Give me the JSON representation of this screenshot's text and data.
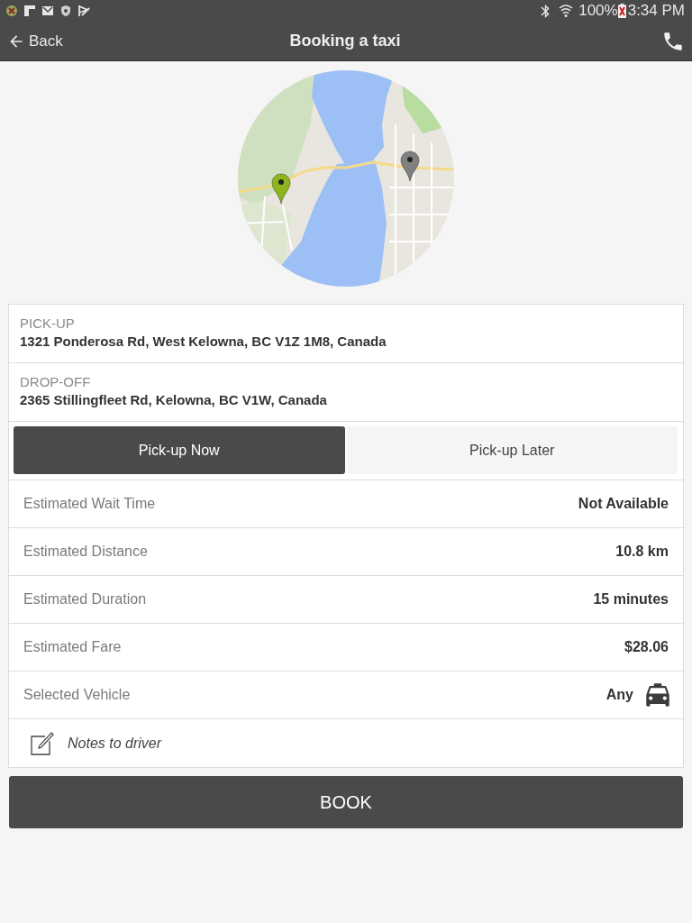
{
  "status_bar": {
    "battery": "100%",
    "time": "3:34 PM"
  },
  "header": {
    "back_label": "Back",
    "title": "Booking a taxi"
  },
  "addresses": [
    {
      "label": "PICK-UP",
      "value": "1321 Ponderosa Rd, West Kelowna, BC V1Z 1M8, Canada"
    },
    {
      "label": "DROP-OFF",
      "value": "2365 Stillingfleet Rd, Kelowna, BC V1W, Canada"
    }
  ],
  "pickup_options": [
    {
      "label": "Pick-up Now",
      "selected": true
    },
    {
      "label": "Pick-up Later",
      "selected": false
    }
  ],
  "details": [
    {
      "kind": "text",
      "label": "Estimated Wait Time",
      "value": "Not Available"
    },
    {
      "kind": "text",
      "label": "Estimated Distance",
      "value": "10.8 km"
    },
    {
      "kind": "text",
      "label": "Estimated Duration",
      "value": "15 minutes"
    },
    {
      "kind": "text",
      "label": "Estimated Fare",
      "value": "$28.06"
    },
    {
      "kind": "vehicle",
      "label": "Selected Vehicle",
      "value": "Any"
    }
  ],
  "notes": {
    "placeholder": "Notes to driver"
  },
  "book_button": {
    "label": "BOOK"
  }
}
